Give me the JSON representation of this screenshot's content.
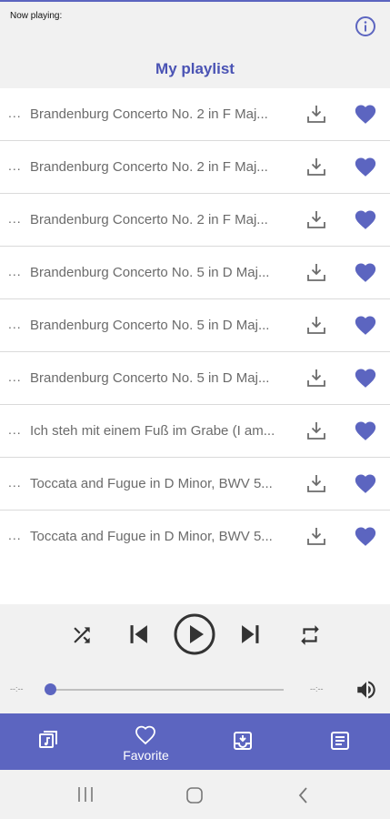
{
  "header": {
    "now_playing": "Now playing:",
    "title": "My playlist"
  },
  "playlist": [
    {
      "title": "Brandenburg Concerto No. 2 in F Maj...",
      "favorite": true
    },
    {
      "title": "Brandenburg Concerto No. 2 in F Maj...",
      "favorite": true
    },
    {
      "title": "Brandenburg Concerto No. 2 in F Maj...",
      "favorite": true
    },
    {
      "title": "Brandenburg Concerto No. 5 in D Maj...",
      "favorite": true
    },
    {
      "title": "Brandenburg Concerto No. 5 in D Maj...",
      "favorite": true
    },
    {
      "title": "Brandenburg Concerto No. 5 in D Maj...",
      "favorite": true
    },
    {
      "title": "Ich steh mit einem Fuß im Grabe (I am...",
      "favorite": true
    },
    {
      "title": "Toccata and Fugue in D Minor, BWV 5...",
      "favorite": true
    },
    {
      "title": "Toccata and Fugue in D Minor, BWV 5...",
      "favorite": true
    }
  ],
  "row_more": "...",
  "player": {
    "elapsed": "--:--",
    "duration": "--:--",
    "progress_fraction": 0.0,
    "icons": [
      "shuffle-icon",
      "skip-previous-icon",
      "play-icon",
      "skip-next-icon",
      "repeat-icon",
      "volume-icon"
    ]
  },
  "bottom_nav": {
    "items": [
      {
        "icon": "music-note-icon",
        "label": ""
      },
      {
        "icon": "heart-outline-icon",
        "label": "Favorite"
      },
      {
        "icon": "download-tray-icon",
        "label": ""
      },
      {
        "icon": "notes-icon",
        "label": ""
      }
    ],
    "active_index": 1
  },
  "system_nav": {
    "icons": [
      "recents-icon",
      "home-icon",
      "back-icon"
    ]
  },
  "colors": {
    "accent": "#5c65c0",
    "heart": "#5c65c0",
    "background": "#f1f1f1",
    "row_background": "#ffffff",
    "row_text": "#6b6b6b"
  }
}
